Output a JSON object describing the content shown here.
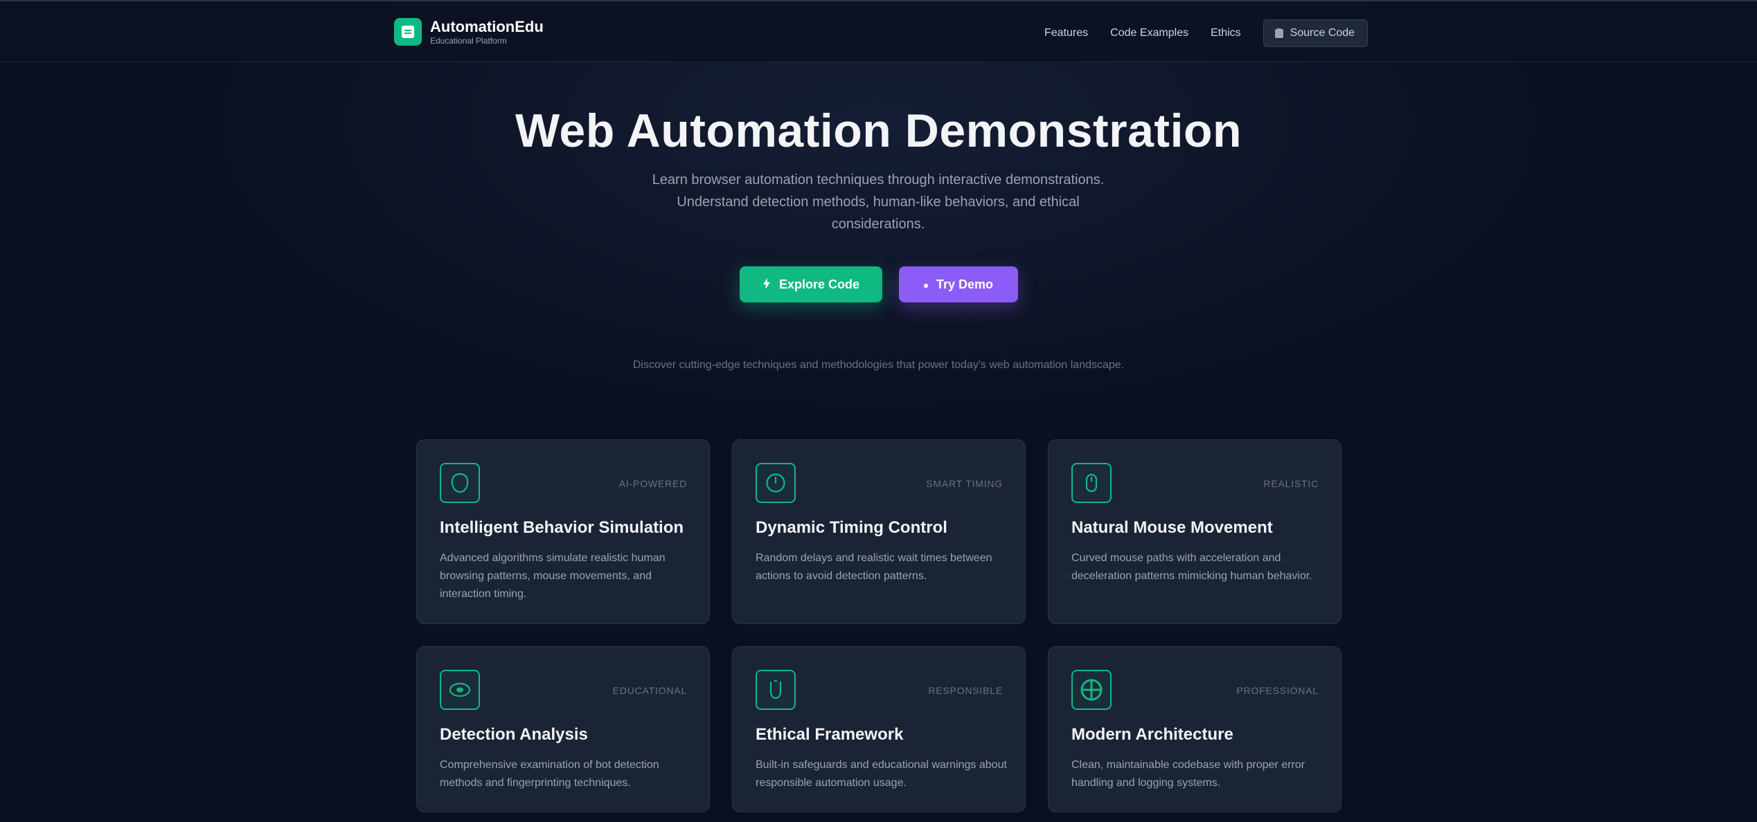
{
  "header": {
    "brand_name": "AutomationEdu",
    "brand_sub": "Educational Platform",
    "nav": [
      "Features",
      "Code Examples",
      "Ethics"
    ],
    "source_code_label": "Source Code"
  },
  "hero": {
    "title": "Web Automation Demonstration",
    "subtitle": "Learn browser automation techniques through interactive demonstrations. Understand detection methods, human-like behaviors, and ethical considerations.",
    "primary_button": "Explore Code",
    "secondary_button": "Try Demo",
    "tagline": "Discover cutting-edge techniques and methodologies that power today's web automation landscape."
  },
  "features": [
    {
      "icon": "brain-icon",
      "badge": "AI-POWERED",
      "title": "Intelligent Behavior Simulation",
      "desc": "Advanced algorithms simulate realistic human browsing patterns, mouse movements, and interaction timing."
    },
    {
      "icon": "clock-icon",
      "badge": "SMART TIMING",
      "title": "Dynamic Timing Control",
      "desc": "Random delays and realistic wait times between actions to avoid detection patterns."
    },
    {
      "icon": "mouse-icon",
      "badge": "REALISTIC",
      "title": "Natural Mouse Movement",
      "desc": "Curved mouse paths with acceleration and deceleration patterns mimicking human behavior."
    },
    {
      "icon": "eye-icon",
      "badge": "EDUCATIONAL",
      "title": "Detection Analysis",
      "desc": "Comprehensive examination of bot detection methods and fingerprinting techniques."
    },
    {
      "icon": "shield-icon",
      "badge": "RESPONSIBLE",
      "title": "Ethical Framework",
      "desc": "Built-in safeguards and educational warnings about responsible automation usage."
    },
    {
      "icon": "architecture-icon",
      "badge": "PROFESSIONAL",
      "title": "Modern Architecture",
      "desc": "Clean, maintainable codebase with proper error handling and logging systems."
    }
  ],
  "colors": {
    "accent_green": "#10b981",
    "accent_purple": "#8b5cf6",
    "background": "#0b1020",
    "card": "#1b2435"
  }
}
